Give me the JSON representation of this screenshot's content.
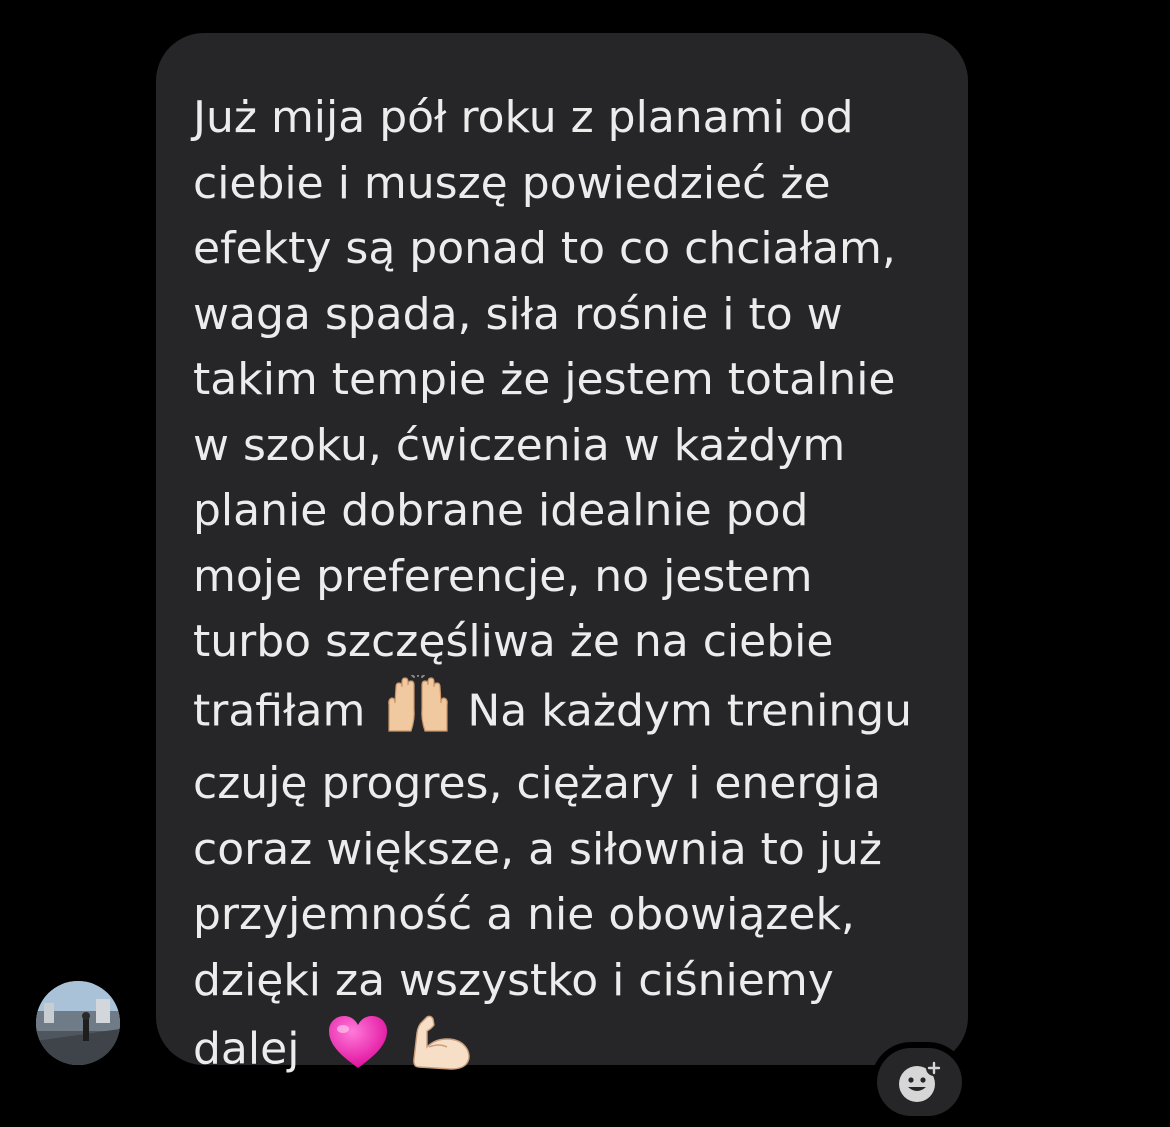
{
  "message": {
    "lines": [
      "Już mija pół roku z planami od",
      "ciebie i muszę powiedzieć że",
      "efekty są ponad to co chciałam,",
      "waga spada, siła rośnie i to w",
      "takim tempie że jestem totalnie",
      "w szoku, ćwiczenia w każdym",
      "planie dobrane idealnie pod",
      "moje preferencje, no jestem",
      "turbo szczęśliwa że na ciebie",
      "trafiłam",
      "Na każdym treningu",
      "czuję progres, ciężary i energia",
      "coraz większe, a siłownia to już",
      "przyjemność a nie obowiązek,",
      "dzięki za wszystko i ciśniemy",
      "dalej"
    ],
    "emojis": [
      "raising-hands",
      "pink-heart",
      "flexed-biceps"
    ]
  },
  "colors": {
    "background": "#000000",
    "bubble": "#262628",
    "text": "#ECECEC"
  },
  "icons": {
    "reaction": "add-reaction-icon",
    "avatar": "user-avatar"
  }
}
